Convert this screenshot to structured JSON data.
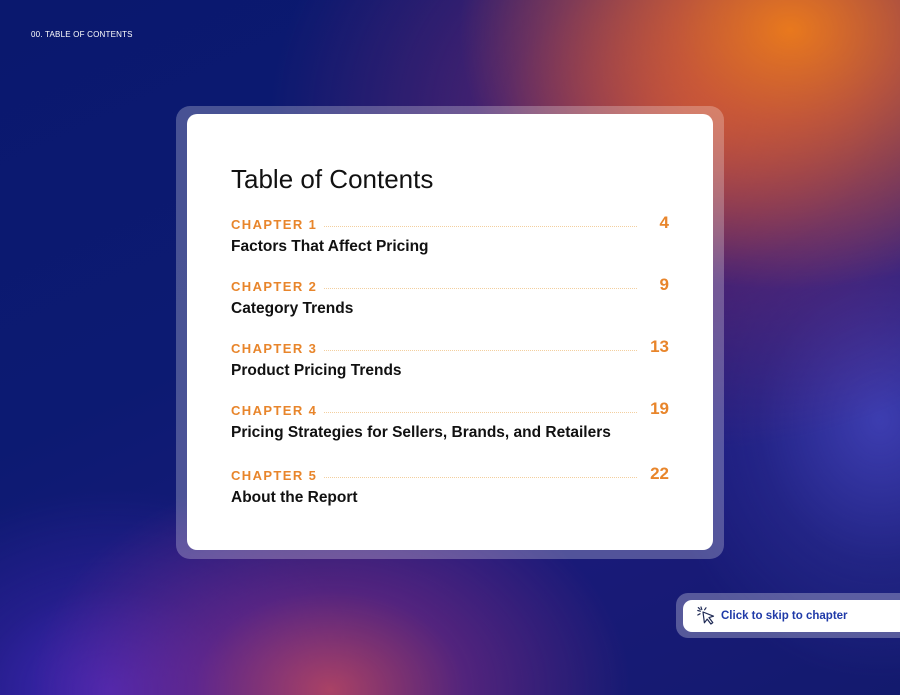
{
  "header": {
    "section_label": "00. TABLE OF CONTENTS"
  },
  "toc": {
    "title": "Table of Contents",
    "entries": [
      {
        "chapter": "CHAPTER 1",
        "name": "Factors That Affect Pricing",
        "page": "4"
      },
      {
        "chapter": "CHAPTER 2",
        "name": "Category Trends",
        "page": "9"
      },
      {
        "chapter": "CHAPTER 3",
        "name": "Product Pricing Trends",
        "page": "13"
      },
      {
        "chapter": "CHAPTER 4",
        "name": "Pricing Strategies for Sellers, Brands, and Retailers",
        "page": "19"
      },
      {
        "chapter": "CHAPTER 5",
        "name": "About the Report",
        "page": "22"
      }
    ]
  },
  "skip_hint": {
    "label": "Click to skip to chapter",
    "icon": "cursor-click-icon"
  },
  "colors": {
    "accent": "#e8852b",
    "link_blue": "#1f3aa8",
    "background_navy": "#0c1670",
    "background_orange": "#f07d19"
  }
}
